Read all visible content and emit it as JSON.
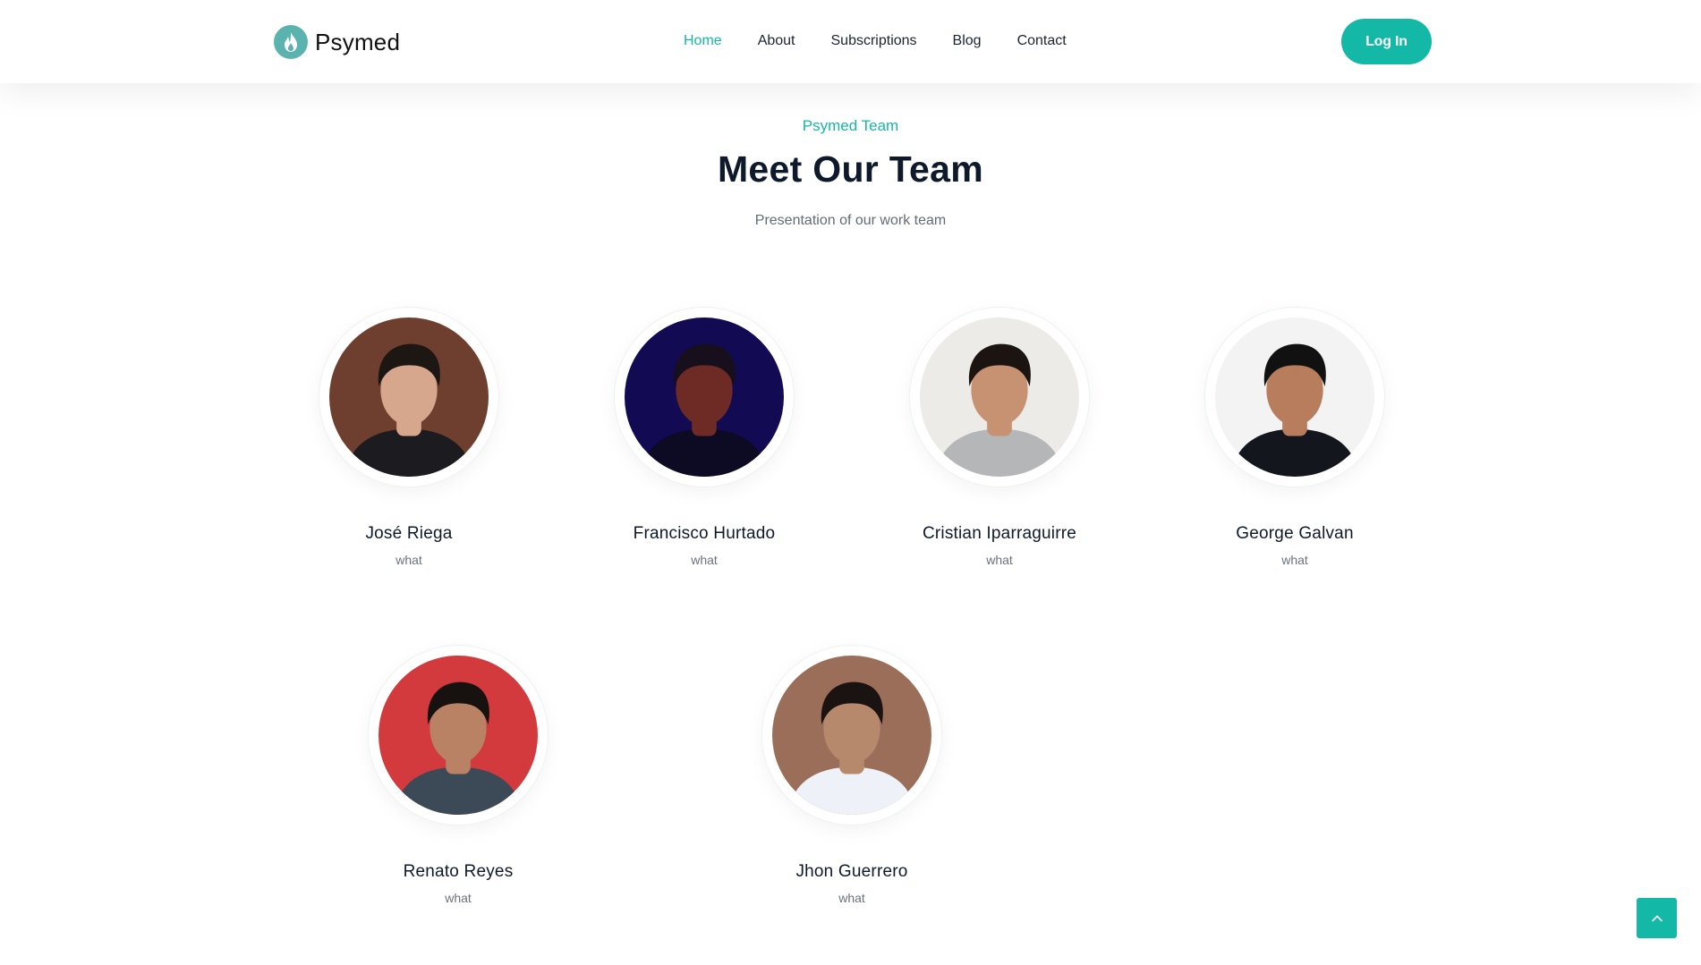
{
  "brand": {
    "name": "Psymed",
    "icon": "flame-icon",
    "icon_color": "#5bb3b0"
  },
  "nav": {
    "items": [
      {
        "label": "Home",
        "active": true
      },
      {
        "label": "About",
        "active": false
      },
      {
        "label": "Subscriptions",
        "active": false
      },
      {
        "label": "Blog",
        "active": false
      },
      {
        "label": "Contact",
        "active": false
      }
    ],
    "login_label": "Log In"
  },
  "section": {
    "eyebrow": "Psymed Team",
    "title": "Meet Our Team",
    "subtitle": "Presentation of our work team"
  },
  "team": [
    {
      "name": "José Riega",
      "role": "what",
      "photo_bg": "#6e3f2f",
      "skin": "#d7a78d",
      "hair": "#1d1714",
      "shirt": "#1c1c20"
    },
    {
      "name": "Francisco Hurtado",
      "role": "what",
      "photo_bg": "#120a52",
      "skin": "#6e2a25",
      "hair": "#180f1d",
      "shirt": "#0d0a24"
    },
    {
      "name": "Cristian Iparraguirre",
      "role": "what",
      "photo_bg": "#ecebe8",
      "skin": "#c79272",
      "hair": "#1b1410",
      "shirt": "#b4b6b8"
    },
    {
      "name": "George Galvan",
      "role": "what",
      "photo_bg": "#f3f3f3",
      "skin": "#b87d5c",
      "hair": "#111111",
      "shirt": "#14161d"
    },
    {
      "name": "Renato Reyes",
      "role": "what",
      "photo_bg": "#d33a3d",
      "skin": "#b98264",
      "hair": "#17110f",
      "shirt": "#3c4a57"
    },
    {
      "name": "Jhon Guerrero",
      "role": "what",
      "photo_bg": "#9b6e5a",
      "skin": "#b7896c",
      "hair": "#1a1311",
      "shirt": "#eef2f8"
    }
  ],
  "accent_color": "#14b8a6",
  "back_to_top_icon": "chevron-up-icon"
}
